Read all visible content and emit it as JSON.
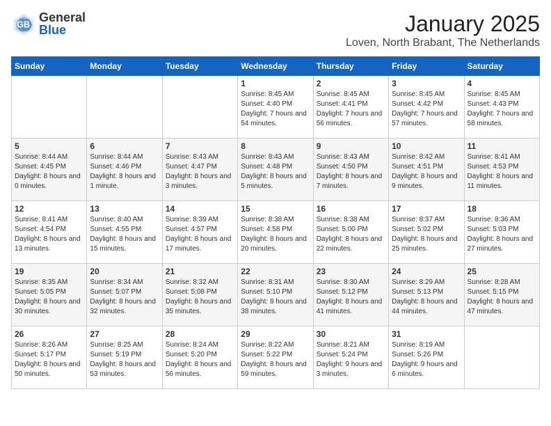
{
  "header": {
    "logo_general": "General",
    "logo_blue": "Blue",
    "title": "January 2025",
    "subtitle": "Loven, North Brabant, The Netherlands"
  },
  "days_of_week": [
    "Sunday",
    "Monday",
    "Tuesday",
    "Wednesday",
    "Thursday",
    "Friday",
    "Saturday"
  ],
  "weeks": [
    [
      {
        "day": "",
        "sunrise": "",
        "sunset": "",
        "daylight": ""
      },
      {
        "day": "",
        "sunrise": "",
        "sunset": "",
        "daylight": ""
      },
      {
        "day": "",
        "sunrise": "",
        "sunset": "",
        "daylight": ""
      },
      {
        "day": "1",
        "sunrise": "Sunrise: 8:45 AM",
        "sunset": "Sunset: 4:40 PM",
        "daylight": "Daylight: 7 hours and 54 minutes."
      },
      {
        "day": "2",
        "sunrise": "Sunrise: 8:45 AM",
        "sunset": "Sunset: 4:41 PM",
        "daylight": "Daylight: 7 hours and 56 minutes."
      },
      {
        "day": "3",
        "sunrise": "Sunrise: 8:45 AM",
        "sunset": "Sunset: 4:42 PM",
        "daylight": "Daylight: 7 hours and 57 minutes."
      },
      {
        "day": "4",
        "sunrise": "Sunrise: 8:45 AM",
        "sunset": "Sunset: 4:43 PM",
        "daylight": "Daylight: 7 hours and 58 minutes."
      }
    ],
    [
      {
        "day": "5",
        "sunrise": "Sunrise: 8:44 AM",
        "sunset": "Sunset: 4:45 PM",
        "daylight": "Daylight: 8 hours and 0 minutes."
      },
      {
        "day": "6",
        "sunrise": "Sunrise: 8:44 AM",
        "sunset": "Sunset: 4:46 PM",
        "daylight": "Daylight: 8 hours and 1 minute."
      },
      {
        "day": "7",
        "sunrise": "Sunrise: 8:43 AM",
        "sunset": "Sunset: 4:47 PM",
        "daylight": "Daylight: 8 hours and 3 minutes."
      },
      {
        "day": "8",
        "sunrise": "Sunrise: 8:43 AM",
        "sunset": "Sunset: 4:48 PM",
        "daylight": "Daylight: 8 hours and 5 minutes."
      },
      {
        "day": "9",
        "sunrise": "Sunrise: 8:43 AM",
        "sunset": "Sunset: 4:50 PM",
        "daylight": "Daylight: 8 hours and 7 minutes."
      },
      {
        "day": "10",
        "sunrise": "Sunrise: 8:42 AM",
        "sunset": "Sunset: 4:51 PM",
        "daylight": "Daylight: 8 hours and 9 minutes."
      },
      {
        "day": "11",
        "sunrise": "Sunrise: 8:41 AM",
        "sunset": "Sunset: 4:53 PM",
        "daylight": "Daylight: 8 hours and 11 minutes."
      }
    ],
    [
      {
        "day": "12",
        "sunrise": "Sunrise: 8:41 AM",
        "sunset": "Sunset: 4:54 PM",
        "daylight": "Daylight: 8 hours and 13 minutes."
      },
      {
        "day": "13",
        "sunrise": "Sunrise: 8:40 AM",
        "sunset": "Sunset: 4:55 PM",
        "daylight": "Daylight: 8 hours and 15 minutes."
      },
      {
        "day": "14",
        "sunrise": "Sunrise: 8:39 AM",
        "sunset": "Sunset: 4:57 PM",
        "daylight": "Daylight: 8 hours and 17 minutes."
      },
      {
        "day": "15",
        "sunrise": "Sunrise: 8:38 AM",
        "sunset": "Sunset: 4:58 PM",
        "daylight": "Daylight: 8 hours and 20 minutes."
      },
      {
        "day": "16",
        "sunrise": "Sunrise: 8:38 AM",
        "sunset": "Sunset: 5:00 PM",
        "daylight": "Daylight: 8 hours and 22 minutes."
      },
      {
        "day": "17",
        "sunrise": "Sunrise: 8:37 AM",
        "sunset": "Sunset: 5:02 PM",
        "daylight": "Daylight: 8 hours and 25 minutes."
      },
      {
        "day": "18",
        "sunrise": "Sunrise: 8:36 AM",
        "sunset": "Sunset: 5:03 PM",
        "daylight": "Daylight: 8 hours and 27 minutes."
      }
    ],
    [
      {
        "day": "19",
        "sunrise": "Sunrise: 8:35 AM",
        "sunset": "Sunset: 5:05 PM",
        "daylight": "Daylight: 8 hours and 30 minutes."
      },
      {
        "day": "20",
        "sunrise": "Sunrise: 8:34 AM",
        "sunset": "Sunset: 5:07 PM",
        "daylight": "Daylight: 8 hours and 32 minutes."
      },
      {
        "day": "21",
        "sunrise": "Sunrise: 8:32 AM",
        "sunset": "Sunset: 5:08 PM",
        "daylight": "Daylight: 8 hours and 35 minutes."
      },
      {
        "day": "22",
        "sunrise": "Sunrise: 8:31 AM",
        "sunset": "Sunset: 5:10 PM",
        "daylight": "Daylight: 8 hours and 38 minutes."
      },
      {
        "day": "23",
        "sunrise": "Sunrise: 8:30 AM",
        "sunset": "Sunset: 5:12 PM",
        "daylight": "Daylight: 8 hours and 41 minutes."
      },
      {
        "day": "24",
        "sunrise": "Sunrise: 8:29 AM",
        "sunset": "Sunset: 5:13 PM",
        "daylight": "Daylight: 8 hours and 44 minutes."
      },
      {
        "day": "25",
        "sunrise": "Sunrise: 8:28 AM",
        "sunset": "Sunset: 5:15 PM",
        "daylight": "Daylight: 8 hours and 47 minutes."
      }
    ],
    [
      {
        "day": "26",
        "sunrise": "Sunrise: 8:26 AM",
        "sunset": "Sunset: 5:17 PM",
        "daylight": "Daylight: 8 hours and 50 minutes."
      },
      {
        "day": "27",
        "sunrise": "Sunrise: 8:25 AM",
        "sunset": "Sunset: 5:19 PM",
        "daylight": "Daylight: 8 hours and 53 minutes."
      },
      {
        "day": "28",
        "sunrise": "Sunrise: 8:24 AM",
        "sunset": "Sunset: 5:20 PM",
        "daylight": "Daylight: 8 hours and 56 minutes."
      },
      {
        "day": "29",
        "sunrise": "Sunrise: 8:22 AM",
        "sunset": "Sunset: 5:22 PM",
        "daylight": "Daylight: 8 hours and 59 minutes."
      },
      {
        "day": "30",
        "sunrise": "Sunrise: 8:21 AM",
        "sunset": "Sunset: 5:24 PM",
        "daylight": "Daylight: 9 hours and 3 minutes."
      },
      {
        "day": "31",
        "sunrise": "Sunrise: 8:19 AM",
        "sunset": "Sunset: 5:26 PM",
        "daylight": "Daylight: 9 hours and 6 minutes."
      },
      {
        "day": "",
        "sunrise": "",
        "sunset": "",
        "daylight": ""
      }
    ]
  ]
}
